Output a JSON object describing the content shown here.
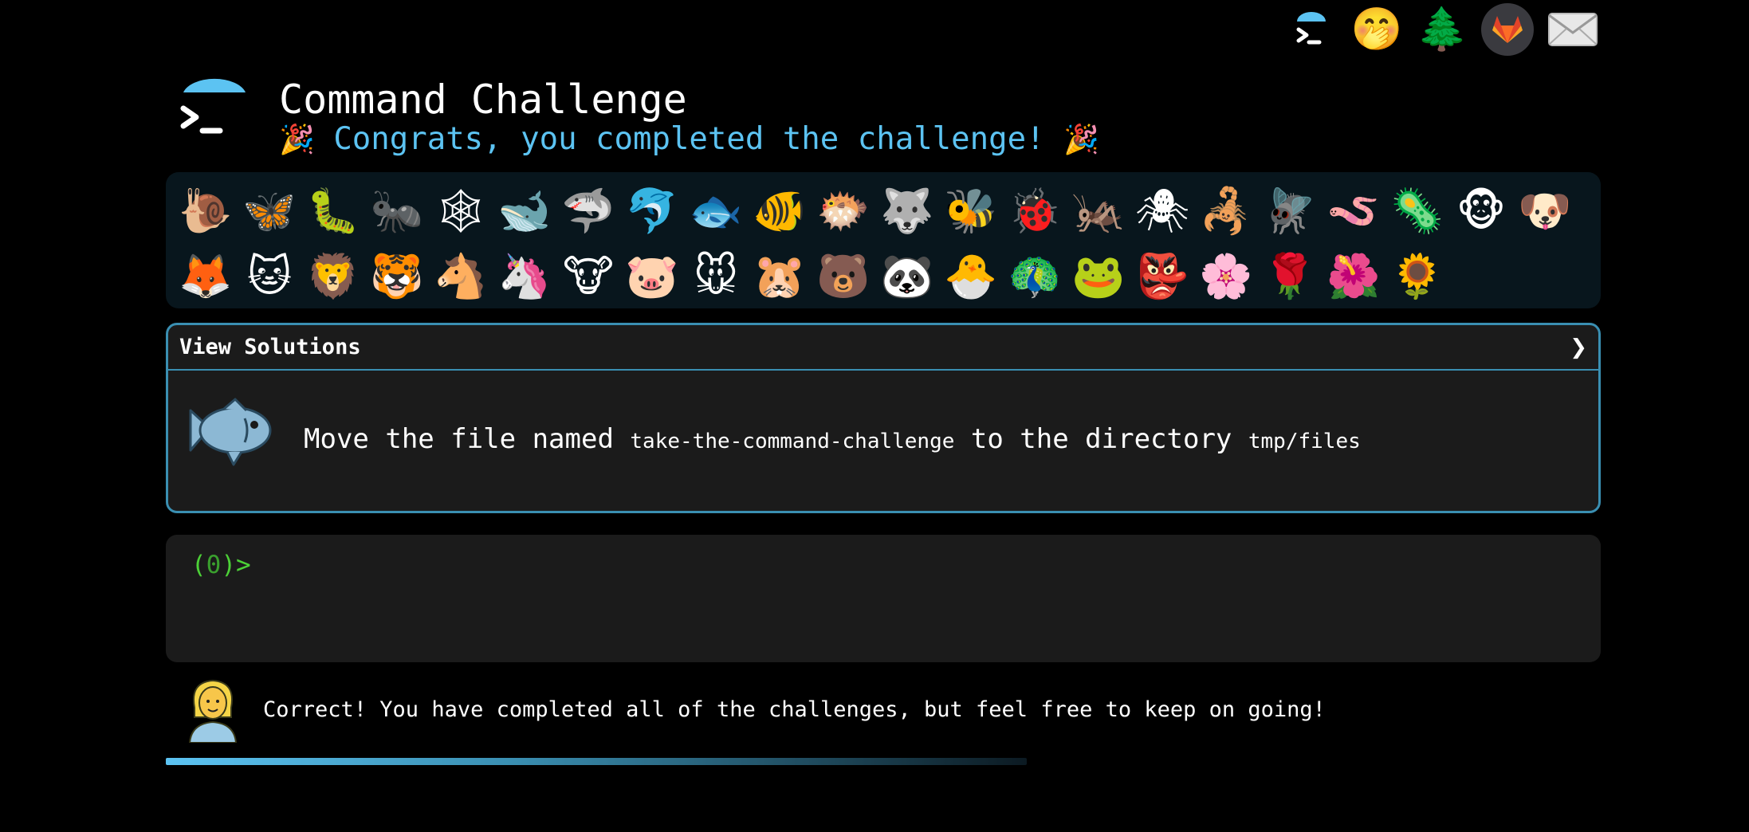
{
  "nav": {
    "items": [
      {
        "name": "terminal-logo-icon",
        "glyph": ""
      },
      {
        "name": "shushing-face-icon",
        "glyph": "🤭"
      },
      {
        "name": "evergreen-tree-icon",
        "glyph": "🌲"
      },
      {
        "name": "gitlab-icon",
        "glyph": "🦊"
      },
      {
        "name": "envelope-icon",
        "glyph": "✉"
      }
    ]
  },
  "header": {
    "title": "Command Challenge",
    "party_emoji": "🎉",
    "subtitle": "Congrats, you completed the challenge!"
  },
  "animals": [
    {
      "name": "snail-icon",
      "glyph": "🐌"
    },
    {
      "name": "butterfly-icon",
      "glyph": "🦋"
    },
    {
      "name": "caterpillar-icon",
      "glyph": "🐛"
    },
    {
      "name": "ant-icon",
      "glyph": "🐜"
    },
    {
      "name": "spider-web-icon",
      "glyph": "🕸"
    },
    {
      "name": "whale-icon",
      "glyph": "🐋"
    },
    {
      "name": "shark-icon",
      "glyph": "🦈"
    },
    {
      "name": "dolphin-icon",
      "glyph": "🐬"
    },
    {
      "name": "fish-icon",
      "glyph": "🐟"
    },
    {
      "name": "tropical-fish-icon",
      "glyph": "🐠"
    },
    {
      "name": "blowfish-icon",
      "glyph": "🐡"
    },
    {
      "name": "wolf-icon",
      "glyph": "🐺"
    },
    {
      "name": "bee-icon",
      "glyph": "🐝"
    },
    {
      "name": "ladybug-icon",
      "glyph": "🐞"
    },
    {
      "name": "cricket-icon",
      "glyph": "🦗"
    },
    {
      "name": "spider-icon",
      "glyph": "🕷"
    },
    {
      "name": "scorpion-icon",
      "glyph": "🦂"
    },
    {
      "name": "fly-icon",
      "glyph": "🪰"
    },
    {
      "name": "worm-icon",
      "glyph": "🪱"
    },
    {
      "name": "microbe-icon",
      "glyph": "🦠"
    },
    {
      "name": "monkey-face-icon",
      "glyph": "🐵"
    },
    {
      "name": "dog-face-icon",
      "glyph": "🐶"
    },
    {
      "name": "fox-icon",
      "glyph": "🦊"
    },
    {
      "name": "cat-face-icon",
      "glyph": "🐱"
    },
    {
      "name": "lion-icon",
      "glyph": "🦁"
    },
    {
      "name": "tiger-face-icon",
      "glyph": "🐯"
    },
    {
      "name": "horse-face-icon",
      "glyph": "🐴"
    },
    {
      "name": "unicorn-icon",
      "glyph": "🦄"
    },
    {
      "name": "cow-face-icon",
      "glyph": "🐮"
    },
    {
      "name": "pig-face-icon",
      "glyph": "🐷"
    },
    {
      "name": "mouse-face-icon",
      "glyph": "🐭"
    },
    {
      "name": "hamster-icon",
      "glyph": "🐹"
    },
    {
      "name": "bear-icon",
      "glyph": "🐻"
    },
    {
      "name": "panda-icon",
      "glyph": "🐼"
    },
    {
      "name": "hatching-chick-icon",
      "glyph": "🐣"
    },
    {
      "name": "peacock-icon",
      "glyph": "🦚"
    },
    {
      "name": "frog-icon",
      "glyph": "🐸"
    },
    {
      "name": "goblin-icon",
      "glyph": "👺"
    },
    {
      "name": "cherry-blossom-icon",
      "glyph": "🌸"
    },
    {
      "name": "rose-icon",
      "glyph": "🌹"
    },
    {
      "name": "hibiscus-icon",
      "glyph": "🌺"
    },
    {
      "name": "sunflower-icon",
      "glyph": "🌻"
    }
  ],
  "solutions": {
    "label": "View Solutions",
    "chevron": "❯"
  },
  "task": {
    "text_1": "Move the file named ",
    "code_1": "take-the-command-challenge",
    "text_2": " to the directory ",
    "code_2": "tmp/files"
  },
  "terminal": {
    "prompt_open": "(",
    "prompt_count": "0",
    "prompt_close": ")>",
    "input_value": ""
  },
  "feedback": {
    "message": "Correct! You have completed all of the challenges, but feel free to keep on going!"
  },
  "progress": {
    "value": 0.6
  },
  "colors": {
    "accent": "#5cc3f2",
    "panel_border": "#3a8fb2",
    "prompt": "#4cd137",
    "panel_bg": "#1b1b1b",
    "animals_bg": "#08161d"
  }
}
